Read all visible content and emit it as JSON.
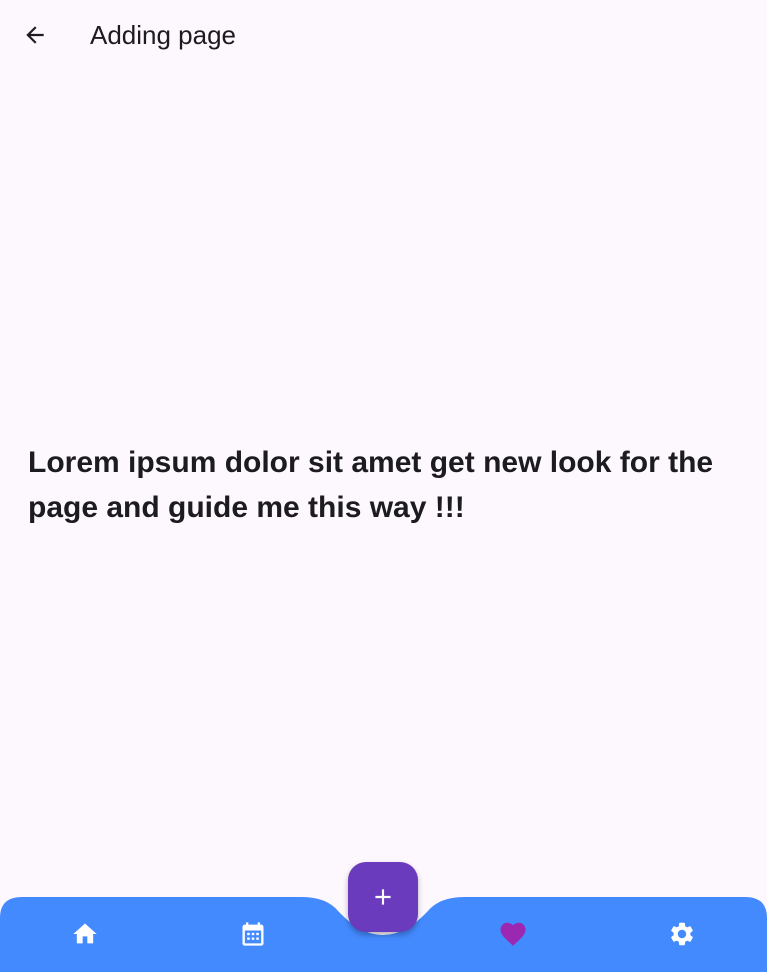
{
  "app_bar": {
    "title": "Adding page",
    "back_icon": "arrow-back-icon"
  },
  "content": {
    "text": "Lorem ipsum dolor sit amet get new look for the page and guide me this way !!!"
  },
  "bottom_nav": {
    "background_color": "#448aff",
    "items": [
      {
        "icon": "home-icon",
        "color": "#ffffff"
      },
      {
        "icon": "calendar-icon",
        "color": "#ffffff"
      },
      {
        "icon": "heart-icon",
        "color": "#9c27b0",
        "selected": true
      },
      {
        "icon": "gear-icon",
        "color": "#ffffff"
      }
    ]
  },
  "fab": {
    "icon": "plus-icon",
    "color": "#6a3bbd"
  }
}
